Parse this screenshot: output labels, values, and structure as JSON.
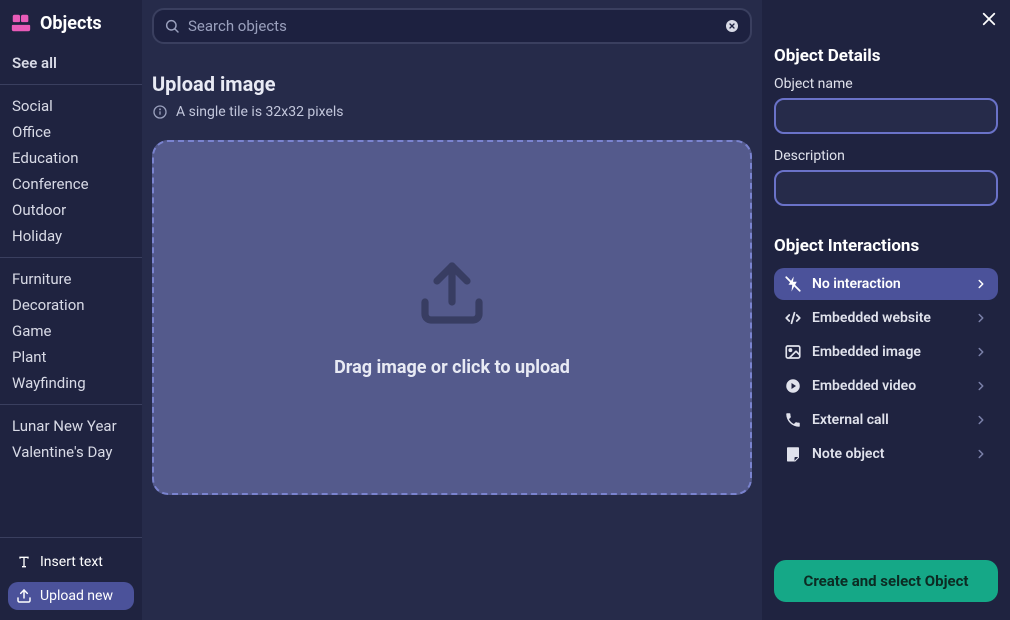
{
  "sidebar": {
    "title": "Objects",
    "see_all": "See all",
    "groups": [
      [
        "Social",
        "Office",
        "Education",
        "Conference",
        "Outdoor",
        "Holiday"
      ],
      [
        "Furniture",
        "Decoration",
        "Game",
        "Plant",
        "Wayfinding"
      ],
      [
        "Lunar New Year",
        "Valentine's Day"
      ]
    ],
    "footer": {
      "insert_text": "Insert text",
      "upload_new": "Upload new"
    }
  },
  "search": {
    "placeholder": "Search objects"
  },
  "upload": {
    "title": "Upload image",
    "hint": "A single tile is 32x32 pixels",
    "dropzone": "Drag image or click to upload"
  },
  "details": {
    "title": "Object Details",
    "name_label": "Object name",
    "name_value": "",
    "desc_label": "Description",
    "desc_value": ""
  },
  "interactions": {
    "title": "Object Interactions",
    "items": [
      {
        "label": "No interaction",
        "icon": "no-interaction",
        "active": true
      },
      {
        "label": "Embedded website",
        "icon": "code",
        "active": false
      },
      {
        "label": "Embedded image",
        "icon": "image",
        "active": false
      },
      {
        "label": "Embedded video",
        "icon": "play",
        "active": false
      },
      {
        "label": "External call",
        "icon": "phone",
        "active": false
      },
      {
        "label": "Note object",
        "icon": "note",
        "active": false
      }
    ]
  },
  "create_button": "Create and select Object"
}
